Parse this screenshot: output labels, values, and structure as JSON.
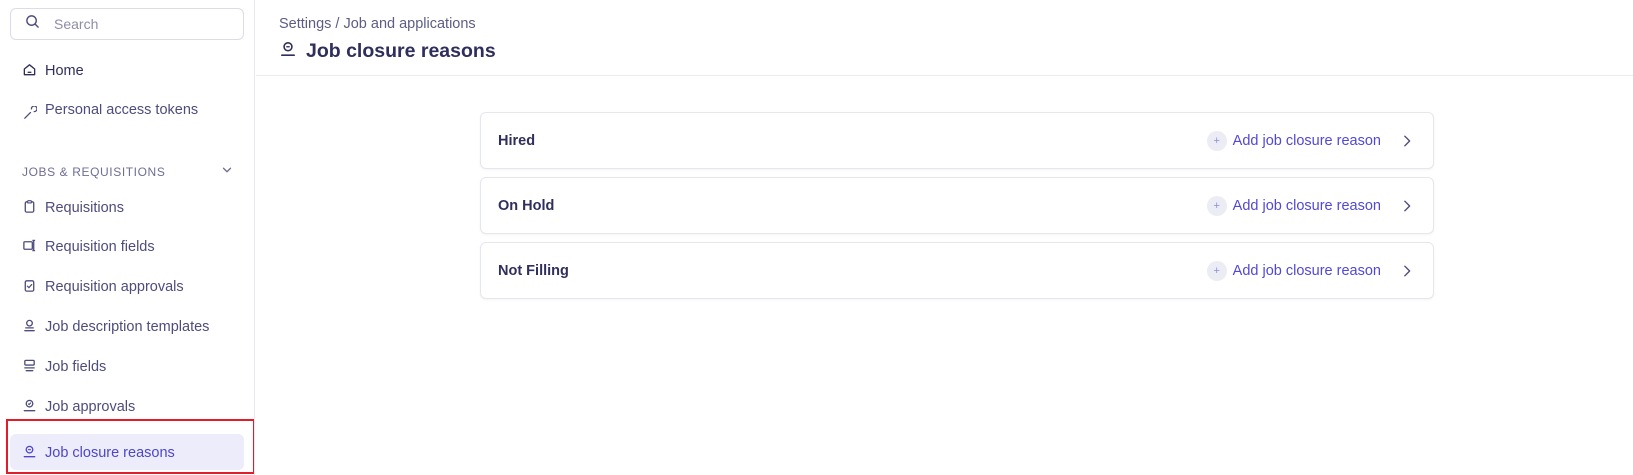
{
  "search": {
    "placeholder": "Search",
    "icon": "search-icon"
  },
  "sidebar": {
    "home_label": "Home",
    "clipped_item_label": "Personal access tokens",
    "section_title": "JOBS & REQUISITIONS",
    "items": [
      {
        "label": "Requisitions",
        "icon": "clipboard-icon"
      },
      {
        "label": "Requisition fields",
        "icon": "fields-icon"
      },
      {
        "label": "Requisition approvals",
        "icon": "clipboard-check-icon"
      },
      {
        "label": "Job description templates",
        "icon": "job-template-icon"
      },
      {
        "label": "Job fields",
        "icon": "job-fields-icon"
      },
      {
        "label": "Job approvals",
        "icon": "job-approvals-icon"
      },
      {
        "label": "Job closure reasons",
        "icon": "job-closure-icon",
        "active": true
      }
    ]
  },
  "header": {
    "breadcrumb": "Settings / Job and applications",
    "title": "Job closure reasons"
  },
  "reasons": [
    {
      "label": "Hired",
      "action": "Add job closure reason"
    },
    {
      "label": "On Hold",
      "action": "Add job closure reason"
    },
    {
      "label": "Not Filling",
      "action": "Add job closure reason"
    }
  ],
  "colors": {
    "accent": "#5148d6",
    "active_bg": "#ececfb",
    "highlight": "#e11d2a",
    "text_dark": "#2f2e5c"
  }
}
